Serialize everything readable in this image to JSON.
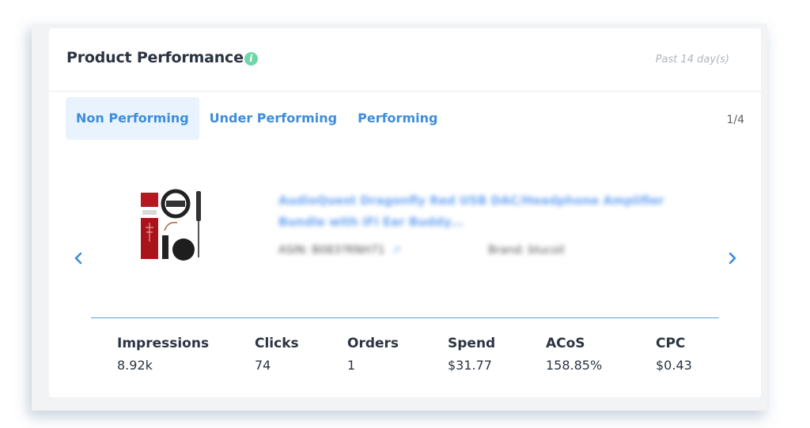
{
  "card": {
    "title": "Product Performance",
    "info_icon": "info-icon",
    "period": "Past 14 day(s)"
  },
  "tabs": [
    {
      "label": "Non Performing",
      "active": true
    },
    {
      "label": "Under Performing",
      "active": false
    },
    {
      "label": "Performing",
      "active": false
    }
  ],
  "pager": "1/4",
  "carousel": {
    "prev_icon": "chevron-left-icon",
    "next_icon": "chevron-right-icon"
  },
  "product": {
    "image_icon": "product-image",
    "name": "AudioQuest Dragonfly Red USB DAC/Headphone Amplifier Bundle with iFi Ear Buddy...",
    "asin_label": "ASIN:",
    "asin": "B083?RNH71",
    "asin_link_icon": "external-link-icon",
    "brand_label": "Brand:",
    "brand": "blucoil"
  },
  "metrics": [
    {
      "label": "Impressions",
      "value": "8.92k"
    },
    {
      "label": "Clicks",
      "value": "74"
    },
    {
      "label": "Orders",
      "value": "1"
    },
    {
      "label": "Spend",
      "value": "$31.77"
    },
    {
      "label": "ACoS",
      "value": "158.85%"
    },
    {
      "label": "CPC",
      "value": "$0.43"
    }
  ],
  "colors": {
    "accent": "#3d8ddb",
    "active_tab_bg": "#e9f3fd",
    "info_icon": "#6fd6a8",
    "divider": "#5a9fd6",
    "title_text": "#2b3442"
  }
}
